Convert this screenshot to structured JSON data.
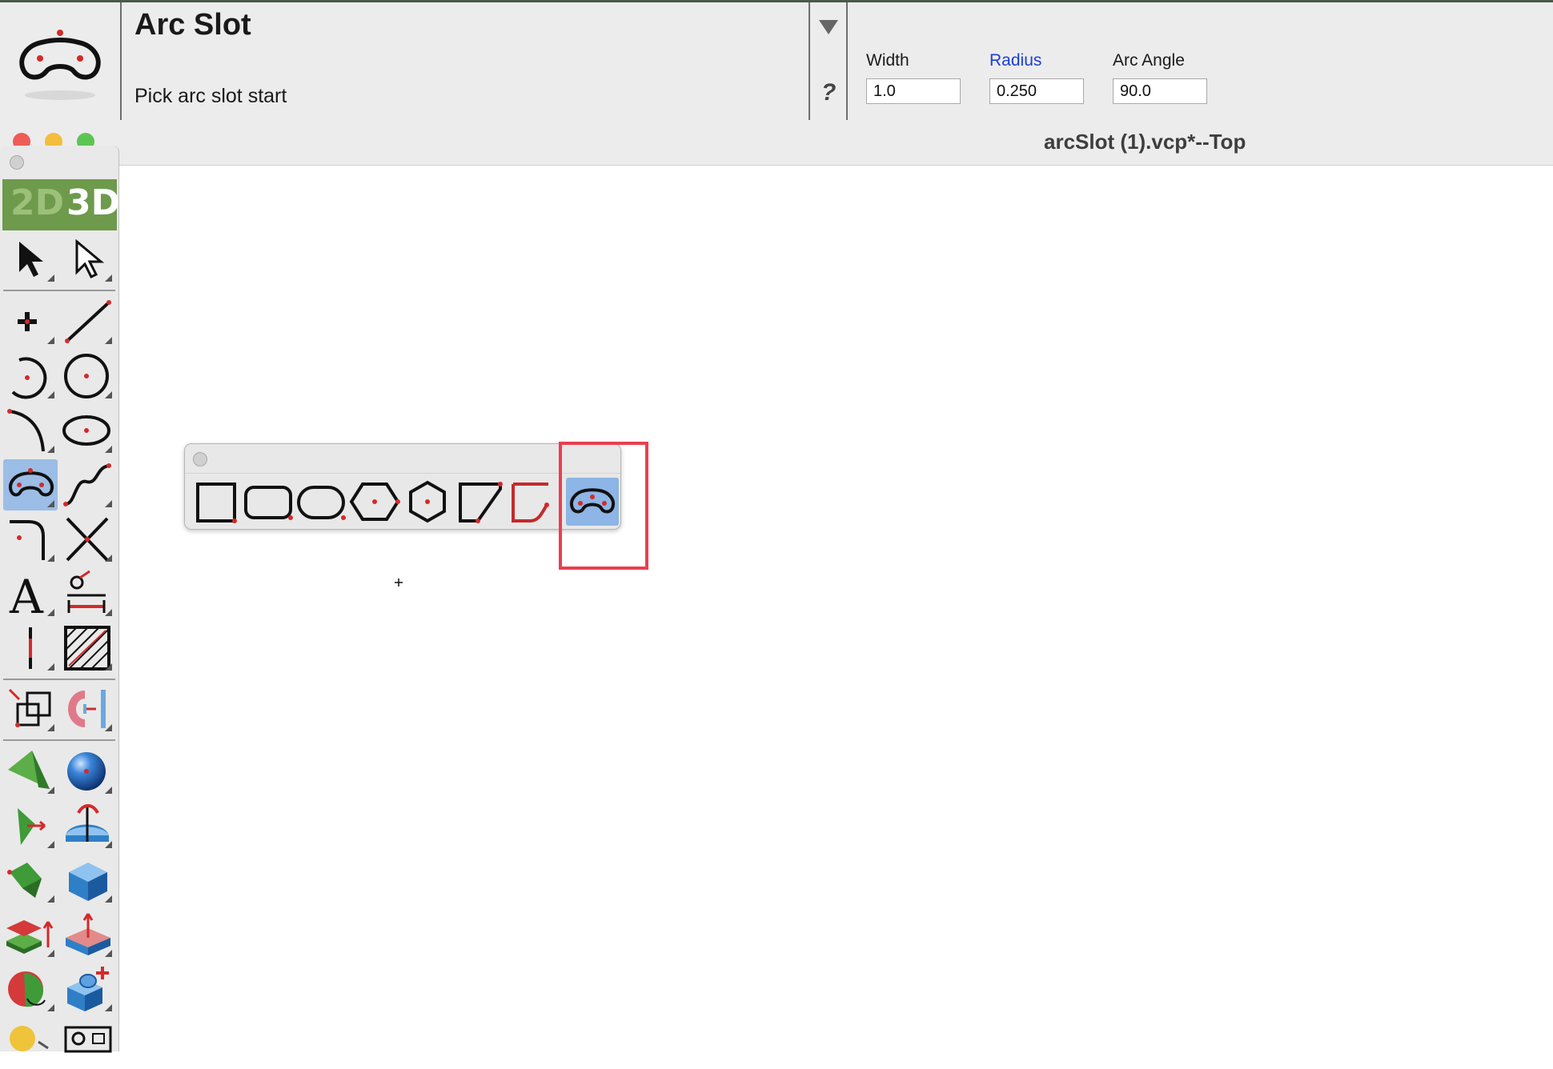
{
  "tool": {
    "title": "Arc Slot",
    "prompt": "Pick arc slot start",
    "help": "?"
  },
  "params": [
    {
      "label": "Width",
      "value": "1.0",
      "highlighted": false
    },
    {
      "label": "Radius",
      "value": "0.250",
      "highlighted": true
    },
    {
      "label": "Arc Angle",
      "value": "90.0",
      "highlighted": false
    }
  ],
  "window": {
    "title": "arcSlot (1).vcp*--Top"
  },
  "palette": {
    "mode_2d": "2D",
    "mode_3d": "3D",
    "active_mode": "3D",
    "selected_tool": "arc-slot"
  },
  "shape_palette": {
    "items": [
      "rectangle",
      "rounded-rectangle",
      "obround",
      "polygon",
      "hexagon",
      "chamfer-rectangle",
      "corner-shape",
      "arc-slot"
    ],
    "selected": "arc-slot"
  },
  "colors": {
    "accent_blue": "#1a3ed6",
    "selection": "#9bbde6",
    "highlight_box": "#e84050",
    "mode_green": "#6e9a4c",
    "point_red": "#d42a2a"
  }
}
